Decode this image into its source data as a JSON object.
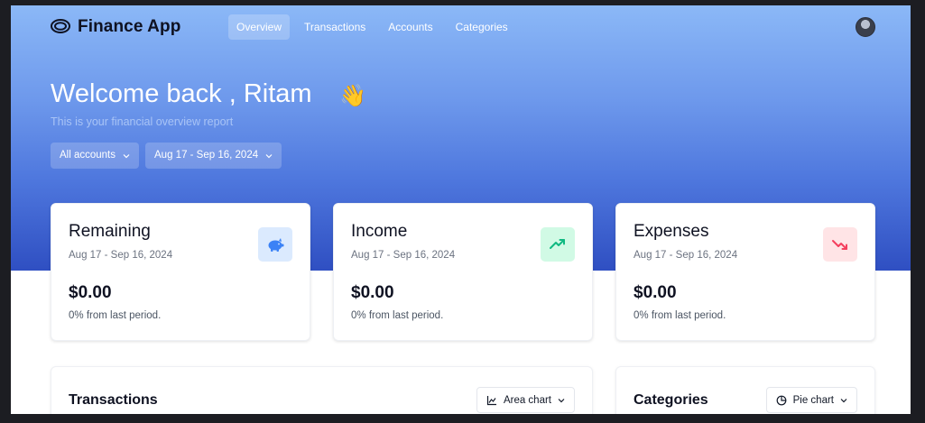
{
  "app": {
    "title": "Finance App"
  },
  "nav": [
    {
      "label": "Overview",
      "active": true
    },
    {
      "label": "Transactions",
      "active": false
    },
    {
      "label": "Accounts",
      "active": false
    },
    {
      "label": "Categories",
      "active": false
    }
  ],
  "hero": {
    "welcome": "Welcome back , Ritam",
    "wave_emoji": "👋",
    "subtitle": "This is your financial overview report",
    "filters": {
      "accounts": "All accounts",
      "date_range": "Aug 17 - Sep 16, 2024"
    }
  },
  "cards": [
    {
      "title": "Remaining",
      "date": "Aug 17 - Sep 16, 2024",
      "amount": "$0.00",
      "change": "0% from last period.",
      "icon": "piggy-bank-icon",
      "icon_color": "#3b82f6",
      "icon_bg": "#dbeafe"
    },
    {
      "title": "Income",
      "date": "Aug 17 - Sep 16, 2024",
      "amount": "$0.00",
      "change": "0% from last period.",
      "icon": "trending-up-icon",
      "icon_color": "#10b981",
      "icon_bg": "#d1fae5"
    },
    {
      "title": "Expenses",
      "date": "Aug 17 - Sep 16, 2024",
      "amount": "$0.00",
      "change": "0% from last period.",
      "icon": "trending-down-icon",
      "icon_color": "#f43f5e",
      "icon_bg": "#ffe4e6"
    }
  ],
  "panels": {
    "transactions": {
      "title": "Transactions",
      "chart_select": "Area chart"
    },
    "categories": {
      "title": "Categories",
      "chart_select": "Pie chart"
    }
  }
}
